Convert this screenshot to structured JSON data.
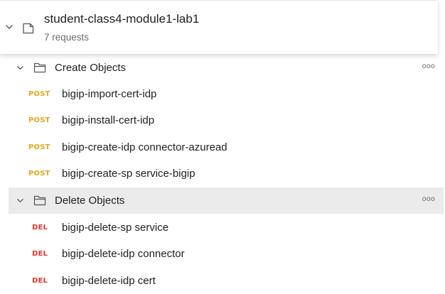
{
  "collection": {
    "title": "student-class4-module1-lab1",
    "subtitle": "7 requests"
  },
  "folders": [
    {
      "label": "Create Objects",
      "more": "ooo",
      "requests": [
        {
          "method": "POST",
          "name": "bigip-import-cert-idp"
        },
        {
          "method": "POST",
          "name": "bigip-install-cert-idp"
        },
        {
          "method": "POST",
          "name": "bigip-create-idp connector-azuread"
        },
        {
          "method": "POST",
          "name": "bigip-create-sp service-bigip"
        }
      ]
    },
    {
      "label": "Delete Objects",
      "more": "ooo",
      "requests": [
        {
          "method": "DEL",
          "name": "bigip-delete-sp service"
        },
        {
          "method": "DEL",
          "name": "bigip-delete-idp connector"
        },
        {
          "method": "DEL",
          "name": "bigip-delete-idp cert"
        }
      ]
    }
  ],
  "colors": {
    "post": "#e6a817",
    "del": "#e0372b",
    "hover_row": "#ebebeb"
  }
}
